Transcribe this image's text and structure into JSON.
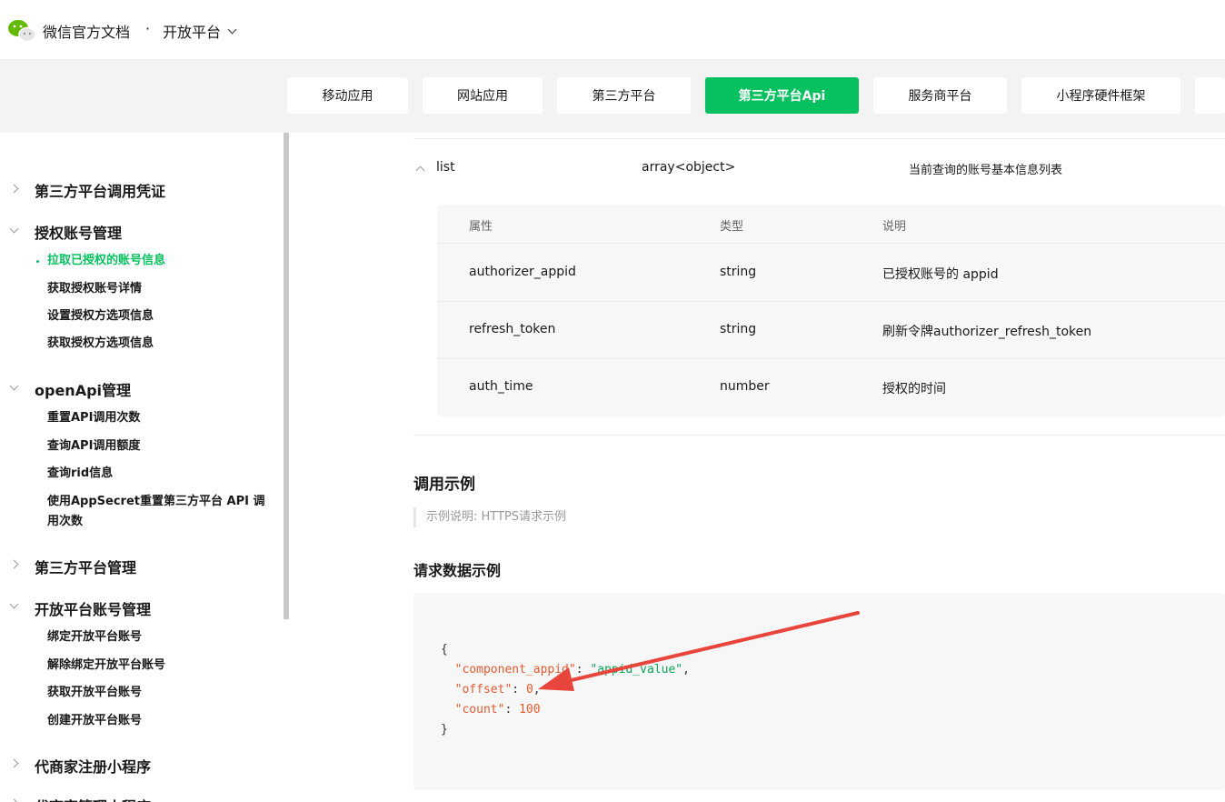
{
  "header": {
    "brand": "微信官方文档",
    "separator": "·",
    "platform": "开放平台"
  },
  "tabs": [
    {
      "label": "移动应用",
      "active": false
    },
    {
      "label": "网站应用",
      "active": false
    },
    {
      "label": "第三方平台",
      "active": false
    },
    {
      "label": "第三方平台Api",
      "active": true
    },
    {
      "label": "服务商平台",
      "active": false
    },
    {
      "label": "小程序硬件框架",
      "active": false
    },
    {
      "label": "",
      "active": false
    }
  ],
  "sidebar": {
    "sections": [
      {
        "label": "第三方平台调用凭证",
        "expanded": false
      },
      {
        "label": "授权账号管理",
        "expanded": true
      },
      {
        "label": "openApi管理",
        "expanded": true
      },
      {
        "label": "第三方平台管理",
        "expanded": false
      },
      {
        "label": "开放平台账号管理",
        "expanded": true
      },
      {
        "label": "代商家注册小程序",
        "expanded": false
      },
      {
        "label": "代商家管理小程序",
        "expanded": false
      }
    ],
    "items": {
      "auth": [
        "拉取已授权的账号信息",
        "获取授权账号详情",
        "设置授权方选项信息",
        "获取授权方选项信息"
      ],
      "openapi": [
        "重置API调用次数",
        "查询API调用额度",
        "查询rid信息",
        "使用AppSecret重置第三方平台 API 调用次数"
      ],
      "open_account": [
        "绑定开放平台账号",
        "解除绑定开放平台账号",
        "获取开放平台账号",
        "创建开放平台账号"
      ]
    }
  },
  "list_row": {
    "name": "list",
    "type": "array<object>",
    "desc": "当前查询的账号基本信息列表"
  },
  "subtable": {
    "headers": [
      "属性",
      "类型",
      "说明"
    ],
    "rows": [
      [
        "authorizer_appid",
        "string",
        "已授权账号的 appid"
      ],
      [
        "refresh_token",
        "string",
        "刷新令牌authorizer_refresh_token"
      ],
      [
        "auth_time",
        "number",
        "授权的时间"
      ]
    ]
  },
  "example": {
    "title": "调用示例",
    "note": "示例说明: HTTPS请求示例",
    "request_title": "请求数据示例",
    "code": {
      "open": "{",
      "close": "}",
      "lines": [
        {
          "key": "\"component_appid\"",
          "value": "\"appid_value\"",
          "kind": "string",
          "comma": ","
        },
        {
          "key": "\"offset\"",
          "value": "0",
          "kind": "number",
          "comma": ","
        },
        {
          "key": "\"count\"",
          "value": "100",
          "kind": "number",
          "comma": ""
        }
      ]
    }
  },
  "colors": {
    "accent": "#07c160",
    "annotation_arrow": "#e8453c"
  }
}
